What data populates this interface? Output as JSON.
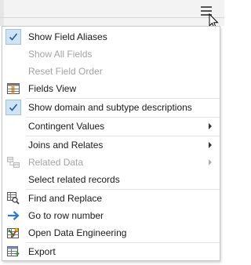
{
  "menu": {
    "items": [
      {
        "label": "Show Field Aliases",
        "icon": "check-icon",
        "checked": true,
        "enabled": true
      },
      {
        "label": "Show All Fields",
        "enabled": false
      },
      {
        "label": "Reset Field Order",
        "enabled": false
      },
      {
        "label": "Fields View",
        "icon": "fields-view-icon",
        "enabled": true
      },
      {
        "label": "Show domain and subtype descriptions",
        "icon": "check-icon",
        "checked": true,
        "enabled": true
      },
      {
        "label": "Contingent Values",
        "enabled": true,
        "submenu": true
      },
      {
        "label": "Joins and Relates",
        "enabled": true,
        "submenu": true
      },
      {
        "label": "Related Data",
        "icon": "related-data-icon",
        "enabled": false,
        "submenu": true
      },
      {
        "label": "Select related records",
        "enabled": true
      },
      {
        "label": "Find and Replace",
        "icon": "find-replace-icon",
        "enabled": true
      },
      {
        "label": "Go to row number",
        "icon": "go-to-row-icon",
        "enabled": true
      },
      {
        "label": "Open Data Engineering",
        "icon": "data-engineering-icon",
        "enabled": true
      },
      {
        "label": "Export",
        "icon": "export-icon",
        "enabled": true
      }
    ]
  },
  "colors": {
    "accent": "#2a7ad2",
    "checked_bg": "#cfe3f4",
    "disabled_text": "#a3a3a3"
  }
}
